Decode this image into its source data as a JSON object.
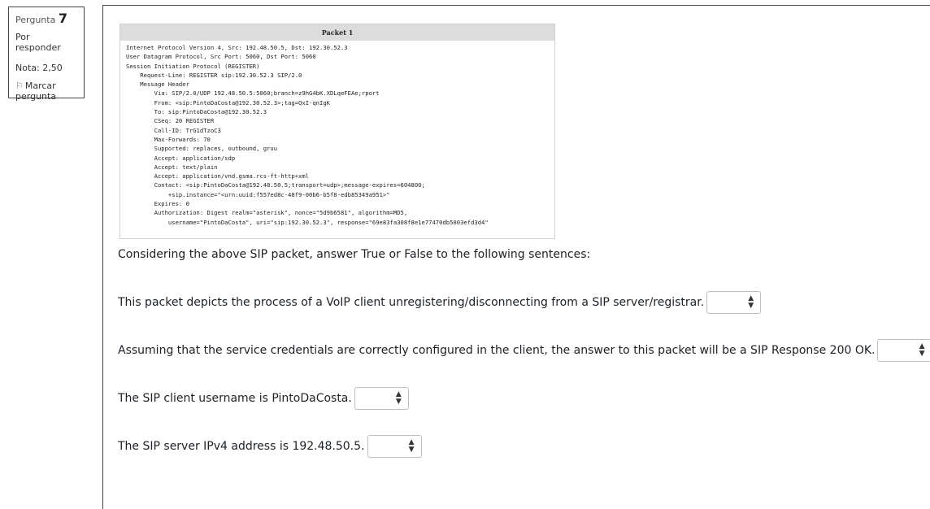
{
  "question_info": {
    "label": "Pergunta",
    "number": "7",
    "state": "Por responder",
    "grade": "Nota: 2,50",
    "flag_label": "Marcar pergunta"
  },
  "packet": {
    "title": "Packet 1",
    "lines": [
      "Internet Protocol Version 4, Src: 192.48.50.5, Dst: 192.30.52.3",
      "User Datagram Protocol, Src Port: 5060, Dst Port: 5060",
      "Session Initiation Protocol (REGISTER)",
      "    Request-Line: REGISTER sip:192.30.52.3 SIP/2.0",
      "    Message Header",
      "        Via: SIP/2.0/UDP 192.48.50.5:5060;branch=z9hG4bK.XDLqeFEAe;rport",
      "        From: <sip:PintoDaCosta@192.30.52.3>;tag=QxI-qnIgK",
      "        To: sip:PintoDaCosta@192.30.52.3",
      "        CSeq: 20 REGISTER",
      "        Call-ID: TrG1dTzoC3",
      "        Max-Forwards: 70",
      "        Supported: replaces, outbound, gruu",
      "        Accept: application/sdp",
      "        Accept: text/plain",
      "        Accept: application/vnd.gsma.rcs-ft-http+xml",
      "        Contact: <sip:PintoDaCosta@192.48.50.5;transport=udp>;message-expires=604800;",
      "            +sip.instance=\"<urn:uuid:f557ed8c-48f9-00b6-b5f8-edb85349a951>\"",
      "        Expires: 0",
      "        Authorization: Digest realm=\"asterisk\", nonce=\"5d9b6581\", algorithm=MD5,",
      "            username=\"PintoDaCosta\", uri=\"sip:192.30.52.3\", response=\"69e83fa308f8e1e77470db5003efd3d4\""
    ]
  },
  "prompt": "Considering the above SIP packet, answer True or False to the following sentences:",
  "questions": [
    {
      "text": "This packet depicts the process of a VoIP client unregistering/disconnecting from a SIP server/registrar.",
      "selected": ""
    },
    {
      "text": "Assuming that the service credentials are correctly configured in the client, the answer to this packet will be a SIP Response 200 OK.",
      "selected": ""
    },
    {
      "text": "The SIP client username is PintoDaCosta.",
      "selected": ""
    },
    {
      "text": "The SIP server IPv4 address is 192.48.50.5.",
      "selected": ""
    }
  ]
}
